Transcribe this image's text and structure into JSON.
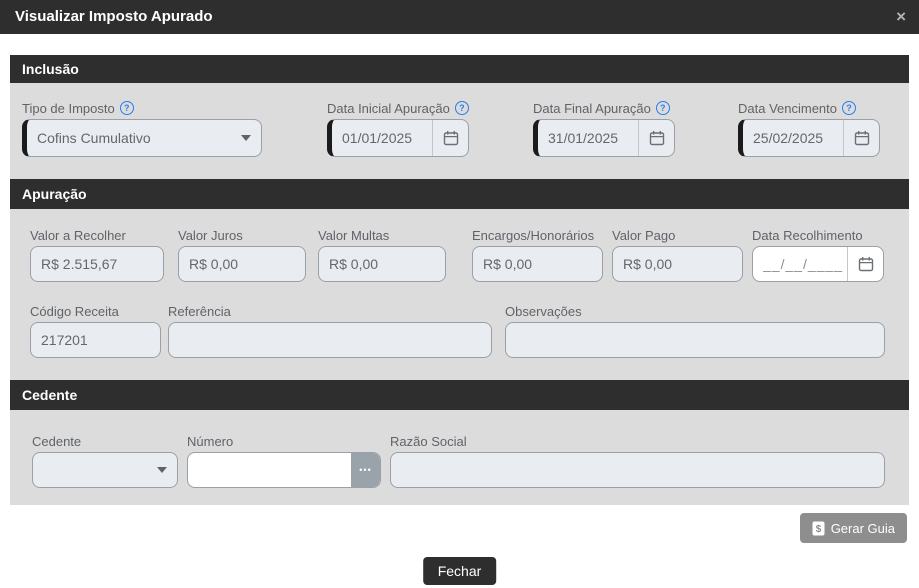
{
  "modal": {
    "title": "Visualizar Imposto Apurado"
  },
  "icons": {
    "close": "×",
    "help": "?",
    "ellipsis": "•••"
  },
  "colors": {
    "header_bg": "#2e2e2e",
    "section_body_bg": "#dcdcdc",
    "field_bg": "#e9edf2",
    "field_accent": "#1b1b1b",
    "help_blue": "#2b7de9",
    "gerar_guia_bg": "#8e8e8e"
  },
  "sections": {
    "inclusao": {
      "title": "Inclusão",
      "tipo_imposto": {
        "label": "Tipo de Imposto",
        "value": "Cofins Cumulativo"
      },
      "data_inicial": {
        "label": "Data Inicial Apuração",
        "value": "01/01/2025"
      },
      "data_final": {
        "label": "Data Final Apuração",
        "value": "31/01/2025"
      },
      "data_vencimento": {
        "label": "Data Vencimento",
        "value": "25/02/2025"
      }
    },
    "apuracao": {
      "title": "Apuração",
      "valor_a_recolher": {
        "label": "Valor a Recolher",
        "value": "R$ 2.515,67"
      },
      "valor_juros": {
        "label": "Valor Juros",
        "value": "R$ 0,00"
      },
      "valor_multas": {
        "label": "Valor Multas",
        "value": "R$ 0,00"
      },
      "encargos_honorarios": {
        "label": "Encargos/Honorários",
        "value": "R$ 0,00"
      },
      "valor_pago": {
        "label": "Valor Pago",
        "value": "R$ 0,00"
      },
      "data_recolhimento": {
        "label": "Data Recolhimento",
        "value": "__/__/____"
      },
      "codigo_receita": {
        "label": "Código Receita",
        "value": "217201"
      },
      "referencia": {
        "label": "Referência",
        "value": ""
      },
      "observacoes": {
        "label": "Observações",
        "value": ""
      }
    },
    "cedente": {
      "title": "Cedente",
      "cedente": {
        "label": "Cedente",
        "value": ""
      },
      "numero": {
        "label": "Número",
        "value": ""
      },
      "razao_social": {
        "label": "Razão Social",
        "value": ""
      }
    }
  },
  "buttons": {
    "gerar_guia": "Gerar Guia",
    "fechar": "Fechar"
  }
}
